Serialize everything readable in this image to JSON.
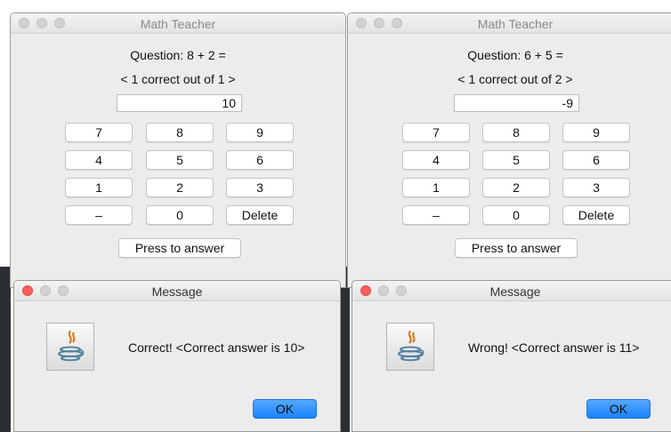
{
  "left": {
    "window_title": "Math Teacher",
    "question": "Question: 8 + 2 =",
    "score": "< 1 correct out of 1 >",
    "answer_value": "10",
    "keypad": [
      "7",
      "8",
      "9",
      "4",
      "5",
      "6",
      "1",
      "2",
      "3",
      "–",
      "0",
      "Delete"
    ],
    "submit_label": "Press to answer",
    "dialog": {
      "title": "Message",
      "text": "Correct! <Correct answer is 10>",
      "ok_label": "OK"
    }
  },
  "right": {
    "window_title": "Math Teacher",
    "question": "Question: 6 + 5 =",
    "score": "< 1 correct out of 2 >",
    "answer_value": "-9",
    "keypad": [
      "7",
      "8",
      "9",
      "4",
      "5",
      "6",
      "1",
      "2",
      "3",
      "–",
      "0",
      "Delete"
    ],
    "submit_label": "Press to answer",
    "dialog": {
      "title": "Message",
      "text": "Wrong! <Correct answer is 11>",
      "ok_label": "OK"
    }
  },
  "icons": [
    "java-coffee-icon"
  ],
  "colors": {
    "ok_button": "#1a82fb",
    "close_dot": "#fc605c",
    "window_bg": "#ececec"
  }
}
